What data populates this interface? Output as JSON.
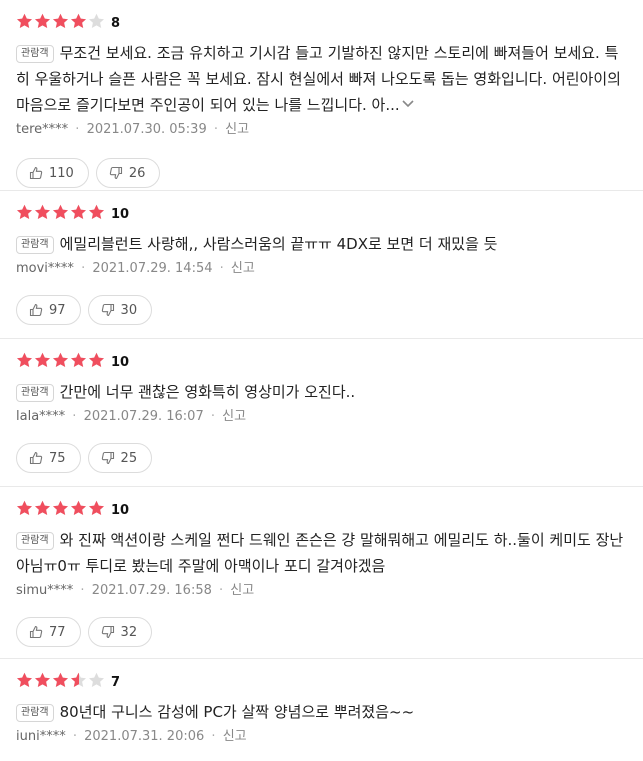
{
  "colors": {
    "star_filled": "#f04e5e",
    "star_empty": "#dddddd"
  },
  "icons": {
    "like": "thumbs-up-icon",
    "dislike": "thumbs-down-icon",
    "more": "chevron-down-icon"
  },
  "reviews": [
    {
      "rating_stars": 4,
      "score": "8",
      "badge": "관람객",
      "text": "무조건 보세요. 조금 유치하고 기시감 들고 기발하진 않지만 스토리에 빠져들어 보세요. 특히 우울하거나 슬픈 사람은 꼭 보세요. 잠시 현실에서 빠져 나오도록 돕는 영화입니다. 어린아이의 마음으로 즐기다보면 주인공이 되어 있는 나를 느낍니다. 아...",
      "user": "tere****",
      "date": "2021.07.30. 05:39",
      "report": "신고",
      "likes": "110",
      "dislikes": "26"
    },
    {
      "rating_stars": 5,
      "score": "10",
      "badge": "관람객",
      "text": "에밀리블런트 사랑해,, 사람스러움의 끝ㅠㅠ 4DX로 보면 더 재밌을 듯",
      "user": "movi****",
      "date": "2021.07.29. 14:54",
      "report": "신고",
      "likes": "97",
      "dislikes": "30"
    },
    {
      "rating_stars": 5,
      "score": "10",
      "badge": "관람객",
      "text": "간만에 너무 괜찮은 영화특히 영상미가 오진다..",
      "user": "lala****",
      "date": "2021.07.29. 16:07",
      "report": "신고",
      "likes": "75",
      "dislikes": "25"
    },
    {
      "rating_stars": 5,
      "score": "10",
      "badge": "관람객",
      "text": "와 진짜 액션이랑 스케일 쩐다 드웨인 존슨은 걍 말해뭐해고 에밀리도 하..둘이 케미도 장난 아님ㅠ0ㅠ 투디로 봤는데 주말에 아맥이나 포디 갈겨야겠음",
      "user": "simu****",
      "date": "2021.07.29. 16:58",
      "report": "신고",
      "likes": "77",
      "dislikes": "32"
    },
    {
      "rating_stars": 3.5,
      "score": "7",
      "badge": "관람객",
      "text": "80년대 구니스 감성에 PC가 살짝 양념으로 뿌려졌음~~",
      "user": "iuni****",
      "date": "2021.07.31. 20:06",
      "report": "신고",
      "likes": "",
      "dislikes": ""
    }
  ]
}
